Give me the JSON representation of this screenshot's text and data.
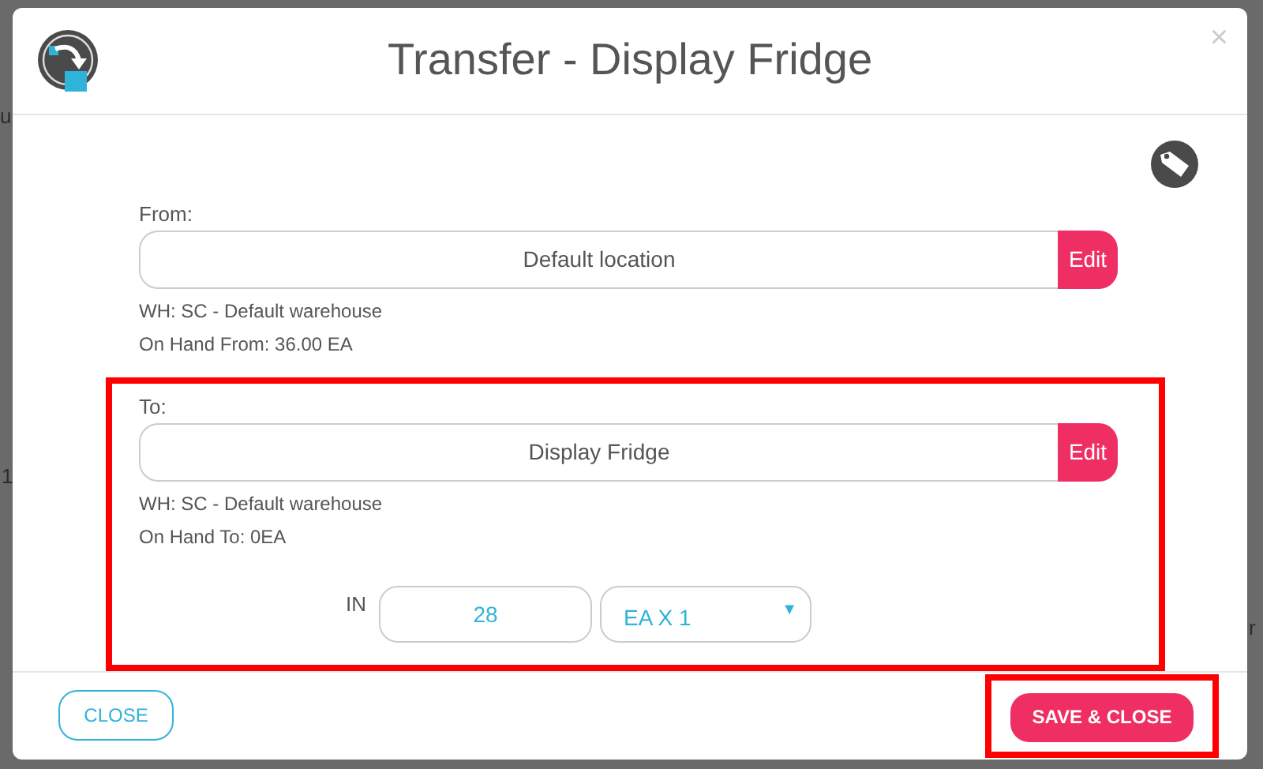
{
  "background_fragments": [
    "u",
    "1",
    "r"
  ],
  "dialog": {
    "title": "Transfer - Display Fridge",
    "close_glyph": "×"
  },
  "from": {
    "label": "From:",
    "location": "Default location",
    "edit": "Edit",
    "warehouse": "WH: SC - Default warehouse",
    "on_hand": "On Hand From: 36.00 EA",
    "highlighted": false
  },
  "to": {
    "label": "To:",
    "location": "Display Fridge",
    "edit": "Edit",
    "warehouse": "WH: SC - Default warehouse",
    "on_hand": "On Hand To: 0EA",
    "highlighted": true
  },
  "quantity": {
    "label": "IN",
    "value": "28",
    "unit": "EA X 1",
    "caret": "▼"
  },
  "footer": {
    "close": "CLOSE",
    "save": "SAVE & CLOSE",
    "save_highlighted": true
  }
}
